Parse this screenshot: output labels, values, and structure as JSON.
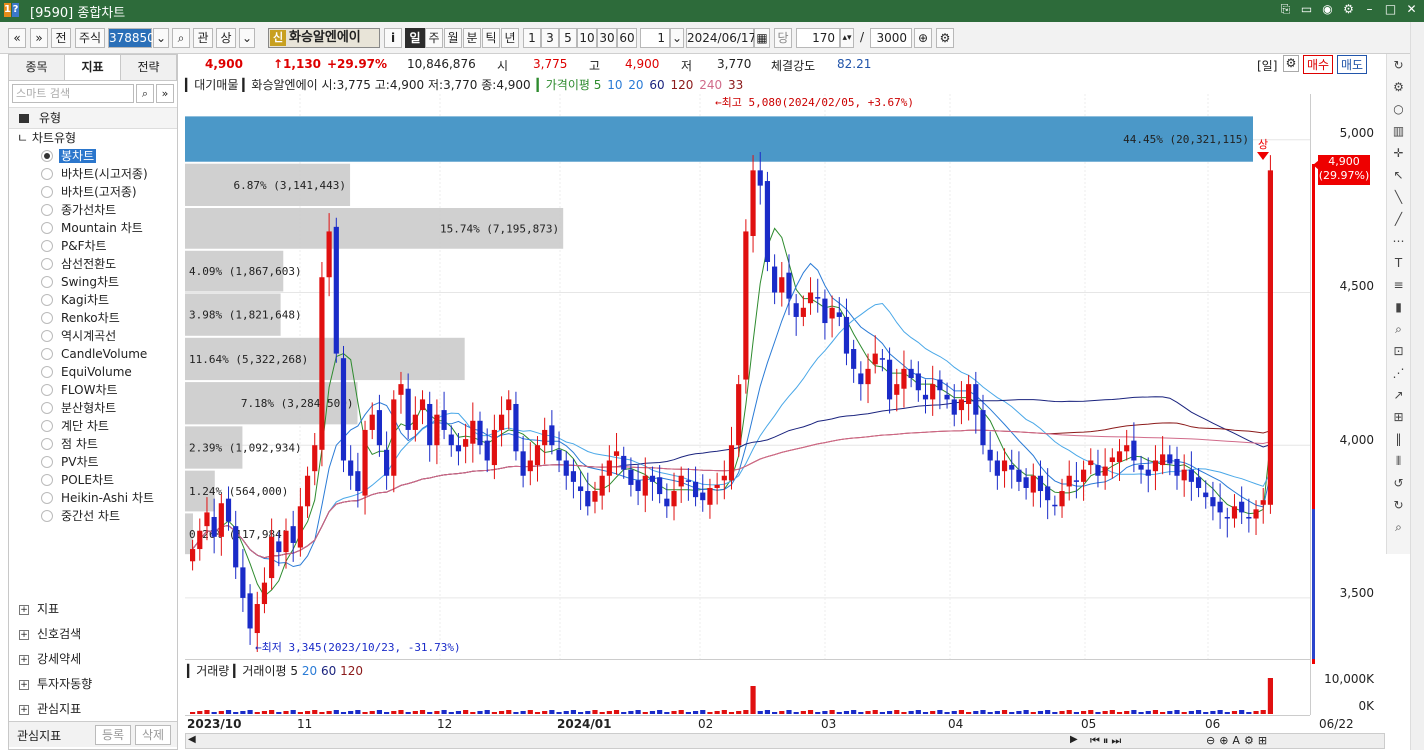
{
  "window": {
    "title": "[9590] 종합차트",
    "icon_left": "1",
    "icon_right": "?"
  },
  "toolbar": {
    "nav_prev": "«",
    "nav_down": "»",
    "market_type": "전",
    "asset_type": "주식",
    "code": "378850",
    "search_icon": "search-icon",
    "btn_gwan": "관",
    "btn_sang": "상",
    "stock_badge": "신",
    "stock_name": "화승알엔에이",
    "info": "i",
    "periods": [
      "일",
      "주",
      "월",
      "분",
      "틱",
      "년"
    ],
    "active_period": "일",
    "intervals": [
      "1",
      "3",
      "5",
      "10",
      "30",
      "60"
    ],
    "interval_value": "1",
    "date": "2024/06/17",
    "unit": "당",
    "count": "170",
    "slash": "/",
    "max_count": "3000"
  },
  "left_panel": {
    "tabs": [
      "종목",
      "지표",
      "전략"
    ],
    "active_tab": "지표",
    "search_placeholder": "스마트 검색",
    "type_header": "유형",
    "tree_root": "차트유형",
    "chart_types": [
      "봉차트",
      "바차트(시고저종)",
      "바차트(고저종)",
      "종가선차트",
      "Mountain 차트",
      "P&F차트",
      "삼선전환도",
      "Swing차트",
      "Kagi차트",
      "Renko차트",
      "역시계곡선",
      "CandleVolume",
      "EquiVolume",
      "FLOW차트",
      "분산형차트",
      "계단 차트",
      "점 차트",
      "PV차트",
      "POLE차트",
      "Heikin-Ashi 차트",
      "중간선 차트"
    ],
    "selected_type": "봉차트",
    "sections": [
      "지표",
      "신호검색",
      "강세약세",
      "투자자동향",
      "관심지표"
    ],
    "bottom": {
      "label": "관심지표",
      "register": "등록",
      "delete": "삭제"
    }
  },
  "quote": {
    "price": "4,900",
    "change": "↑1,130",
    "change_pct": "+29.97%",
    "volume": "10,846,876",
    "open_label": "시",
    "open": "3,775",
    "high_label": "고",
    "high": "4,900",
    "low_label": "저",
    "low": "3,770",
    "strength_label": "체결강도",
    "strength": "82.21",
    "period_tag": "[일]",
    "buy": "매수",
    "sell": "매도"
  },
  "legend": {
    "main": "▎대기매물 ▎화승알엔에이 시:3,775 고:4,900 저:3,770 종:4,900",
    "ma_label": "▎가격이평 5",
    "ma_periods": [
      "10",
      "20",
      "60",
      "120",
      "240",
      "33"
    ],
    "ma_colors": [
      "#2a7bd6",
      "#2a7bd6",
      "#1a237e",
      "#8b1a1a",
      "#d16b8a",
      "#8b1a1a"
    ]
  },
  "annotations": {
    "high": "←최고 5,080(2024/02/05, +3.67%)",
    "low": "←최저 3,345(2023/10/23, -31.73%)",
    "up_mark": "상",
    "last_price": "4,900",
    "last_pct": "(29.97%)"
  },
  "chart_data": {
    "type": "candlestick",
    "y_ticks": [
      "5,000",
      "4,500",
      "4,000",
      "3,500"
    ],
    "ylim": [
      3300,
      5150
    ],
    "x_ticks": [
      "2023/10",
      "11",
      "12",
      "2024/01",
      "02",
      "03",
      "04",
      "05",
      "06",
      "06/22"
    ],
    "volume_profile": [
      {
        "label": "44.45% (20,321,115)",
        "pct": 44.45
      },
      {
        "label": "6.87% (3,141,443)",
        "pct": 6.87
      },
      {
        "label": "15.74% (7,195,873)",
        "pct": 15.74
      },
      {
        "label": "4.09% (1,867,603)",
        "pct": 4.09
      },
      {
        "label": "3.98% (1,821,648)",
        "pct": 3.98
      },
      {
        "label": "11.64% (5,322,268)",
        "pct": 11.64
      },
      {
        "label": "7.18% (3,284,500)",
        "pct": 7.18
      },
      {
        "label": "2.39% (1,092,934)",
        "pct": 2.39
      },
      {
        "label": "1.24% (564,000)",
        "pct": 1.24
      },
      {
        "label": "0.26% (117,984)",
        "pct": 0.26
      }
    ],
    "volume_panel": {
      "legend": "▎거래량 ▎거래이평 5",
      "ma_periods": [
        "20",
        "60",
        "120"
      ],
      "y_ticks": [
        "10,000K",
        "0K"
      ]
    }
  }
}
